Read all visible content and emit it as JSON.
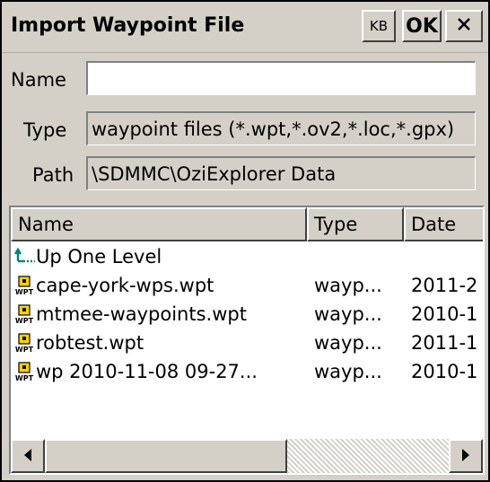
{
  "window": {
    "title": "Import Waypoint File",
    "kb_label": "KB",
    "ok_label": "OK",
    "close_icon": "close-icon"
  },
  "form": {
    "name_label": "Name",
    "name_value": "",
    "type_label": "Type",
    "type_value": "waypoint files (*.wpt,*.ov2,*.loc,*.gpx)",
    "path_label": "Path",
    "path_value": "\\SDMMC\\OziExplorer Data"
  },
  "list": {
    "columns": [
      "Name",
      "Type",
      "Date"
    ],
    "rows": [
      {
        "name": "Up One Level",
        "type": "",
        "date": "",
        "icon": "up-one-level-icon"
      },
      {
        "name": "cape-york-wps.wpt",
        "type": "wayp...",
        "date": "2011-2",
        "icon": "wpt-file-icon"
      },
      {
        "name": "mtmee-waypoints.wpt",
        "type": "wayp...",
        "date": "2010-1",
        "icon": "wpt-file-icon"
      },
      {
        "name": "robtest.wpt",
        "type": "wayp...",
        "date": "2011-1",
        "icon": "wpt-file-icon"
      },
      {
        "name": "wp 2010-11-08 09-27...",
        "type": "wayp...",
        "date": "2010-1",
        "icon": "wpt-file-icon"
      }
    ],
    "icon_labels": {
      "wpt": "WPT"
    }
  },
  "scrollbar": {
    "left_icon": "scroll-left-arrow-icon",
    "right_icon": "scroll-right-arrow-icon",
    "position": 0
  },
  "colors": {
    "face": "#d4d0c8",
    "icon_yellow": "#ffd400",
    "icon_green": "#008080"
  }
}
